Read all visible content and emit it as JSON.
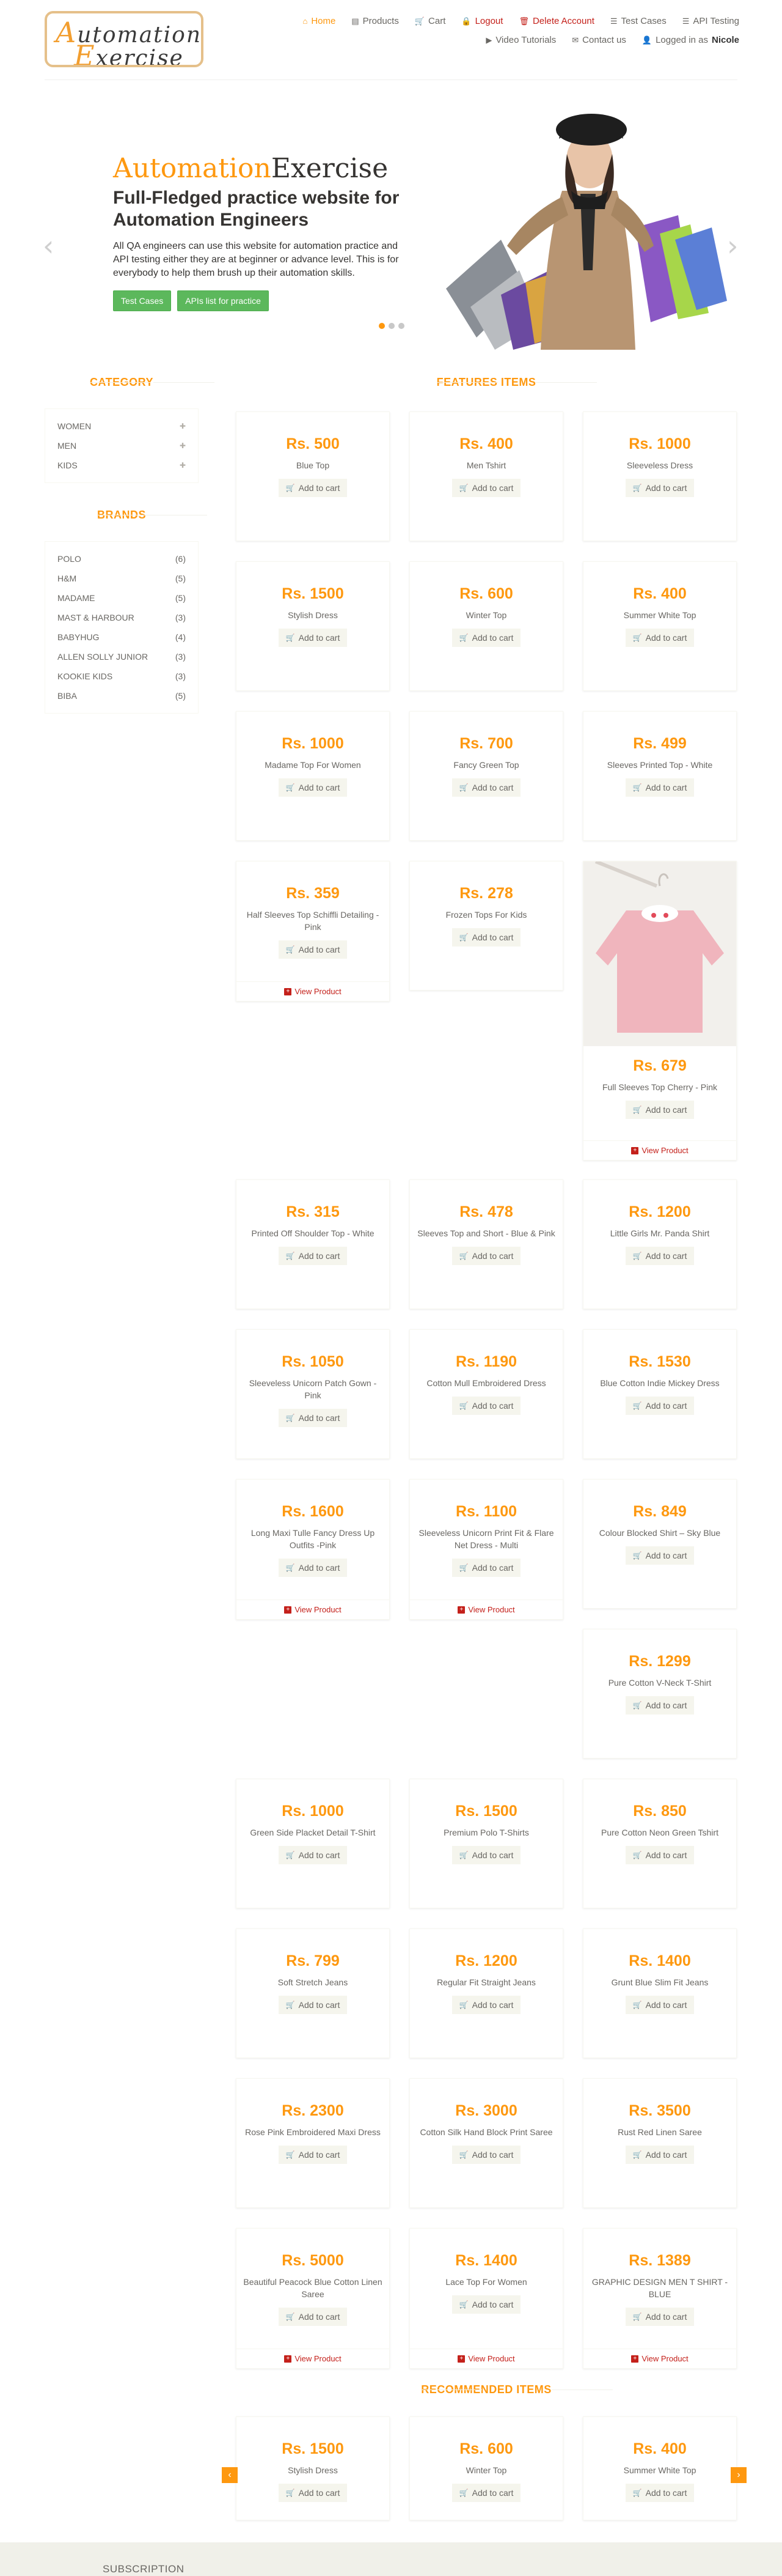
{
  "logo": {
    "line1": "utomation",
    "line1_cap": "A",
    "line2": "xercise",
    "line2_cap": "E"
  },
  "nav": {
    "home": "Home",
    "products": "Products",
    "cart": "Cart",
    "logout": "Logout",
    "delete_account": "Delete Account",
    "test_cases": "Test Cases",
    "api_testing": "API Testing",
    "video_tutorials": "Video Tutorials",
    "contact_us": "Contact us",
    "logged_in_prefix": "Logged in as",
    "logged_in_user": "Nicole"
  },
  "hero": {
    "brand_a": "Automation",
    "brand_b": "Exercise",
    "heading": "Full-Fledged practice website for Automation Engineers",
    "text": "All QA engineers can use this website for automation practice and API testing either they are at beginner or advance level. This is for everybody to help them brush up their automation skills.",
    "btn_test_cases": "Test Cases",
    "btn_apis": "APIs list for practice"
  },
  "sections": {
    "category": "Category",
    "brands": "Brands",
    "features": "Features Items",
    "recommended": "recommended items"
  },
  "categories": [
    {
      "label": "Women"
    },
    {
      "label": "Men"
    },
    {
      "label": "Kids"
    }
  ],
  "brands": [
    {
      "label": "Polo",
      "count": "(6)"
    },
    {
      "label": "H&M",
      "count": "(5)"
    },
    {
      "label": "Madame",
      "count": "(5)"
    },
    {
      "label": "Mast & Harbour",
      "count": "(3)"
    },
    {
      "label": "Babyhug",
      "count": "(4)"
    },
    {
      "label": "Allen Solly Junior",
      "count": "(3)"
    },
    {
      "label": "Kookie Kids",
      "count": "(3)"
    },
    {
      "label": "Biba",
      "count": "(5)"
    }
  ],
  "product_labels": {
    "add_to_cart": "Add to cart",
    "view_product": "View Product"
  },
  "products": [
    {
      "price": "Rs. 500",
      "name": "Blue Top"
    },
    {
      "price": "Rs. 400",
      "name": "Men Tshirt"
    },
    {
      "price": "Rs. 1000",
      "name": "Sleeveless Dress"
    },
    {
      "price": "Rs. 1500",
      "name": "Stylish Dress"
    },
    {
      "price": "Rs. 600",
      "name": "Winter Top"
    },
    {
      "price": "Rs. 400",
      "name": "Summer White Top"
    },
    {
      "price": "Rs. 1000",
      "name": "Madame Top For Women"
    },
    {
      "price": "Rs. 700",
      "name": "Fancy Green Top"
    },
    {
      "price": "Rs. 499",
      "name": "Sleeves Printed Top - White"
    },
    {
      "price": "Rs. 359",
      "name": "Half Sleeves Top Schiffli Detailing - Pink"
    },
    {
      "price": "Rs. 278",
      "name": "Frozen Tops For Kids"
    },
    {
      "price": "Rs. 679",
      "name": "Full Sleeves Top Cherry - Pink"
    },
    {
      "price": "Rs. 315",
      "name": "Printed Off Shoulder Top - White"
    },
    {
      "price": "Rs. 478",
      "name": "Sleeves Top and Short - Blue & Pink"
    },
    {
      "price": "Rs. 1200",
      "name": "Little Girls Mr. Panda Shirt"
    },
    {
      "price": "Rs. 1050",
      "name": "Sleeveless Unicorn Patch Gown - Pink"
    },
    {
      "price": "Rs. 1190",
      "name": "Cotton Mull Embroidered Dress"
    },
    {
      "price": "Rs. 1530",
      "name": "Blue Cotton Indie Mickey Dress"
    },
    {
      "price": "Rs. 1600",
      "name": "Long Maxi Tulle Fancy Dress Up Outfits -Pink"
    },
    {
      "price": "Rs. 1100",
      "name": "Sleeveless Unicorn Print Fit & Flare Net Dress - Multi"
    },
    {
      "price": "Rs. 849",
      "name": "Colour Blocked Shirt – Sky Blue"
    },
    {
      "price": "Rs. 1299",
      "name": "Pure Cotton V-Neck T-Shirt"
    },
    {
      "price": "Rs. 1000",
      "name": "Green Side Placket Detail T-Shirt"
    },
    {
      "price": "Rs. 1500",
      "name": "Premium Polo T-Shirts"
    },
    {
      "price": "Rs. 850",
      "name": "Pure Cotton Neon Green Tshirt"
    },
    {
      "price": "Rs. 799",
      "name": "Soft Stretch Jeans"
    },
    {
      "price": "Rs. 1200",
      "name": "Regular Fit Straight Jeans"
    },
    {
      "price": "Rs. 1400",
      "name": "Grunt Blue Slim Fit Jeans"
    },
    {
      "price": "Rs. 2300",
      "name": "Rose Pink Embroidered Maxi Dress"
    },
    {
      "price": "Rs. 3000",
      "name": "Cotton Silk Hand Block Print Saree"
    },
    {
      "price": "Rs. 3500",
      "name": "Rust Red Linen Saree"
    },
    {
      "price": "Rs. 5000",
      "name": "Beautiful Peacock Blue Cotton Linen Saree"
    },
    {
      "price": "Rs. 1400",
      "name": "Lace Top For Women"
    },
    {
      "price": "Rs. 1389",
      "name": "GRAPHIC DESIGN MEN T SHIRT - BLUE"
    }
  ],
  "recommended": [
    {
      "price": "Rs. 1500",
      "name": "Stylish Dress"
    },
    {
      "price": "Rs. 600",
      "name": "Winter Top"
    },
    {
      "price": "Rs. 400",
      "name": "Summer White Top"
    }
  ],
  "footer": {
    "subscription": "Subscription"
  },
  "colors": {
    "accent": "#fe980f",
    "danger": "#c4211b",
    "green": "#5cb85c"
  }
}
